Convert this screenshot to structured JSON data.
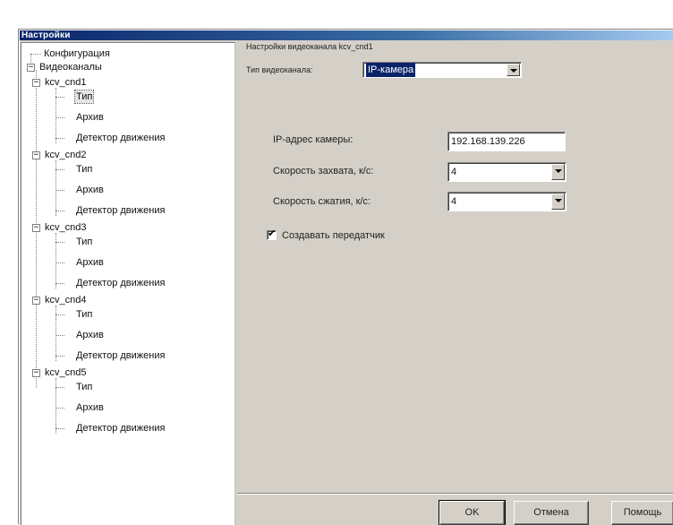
{
  "window": {
    "title": "Настройки"
  },
  "tree": {
    "configuration": "Конфигурация",
    "video_channels": "Видеоканалы",
    "channels": [
      {
        "name": "kcv_cnd1",
        "children": [
          "Тип",
          "Архив",
          "Детектор движения"
        ]
      },
      {
        "name": "kcv_cnd2",
        "children": [
          "Тип",
          "Архив",
          "Детектор движения"
        ]
      },
      {
        "name": "kcv_cnd3",
        "children": [
          "Тип",
          "Архив",
          "Детектор движения"
        ]
      },
      {
        "name": "kcv_cnd4",
        "children": [
          "Тип",
          "Архив",
          "Детектор движения"
        ]
      },
      {
        "name": "kcv_cnd5",
        "children": [
          "Тип",
          "Архив",
          "Детектор движения"
        ]
      }
    ],
    "expander_symbol": "−"
  },
  "panel": {
    "header": "Настройки видеоканала kcv_cnd1",
    "type_label": "Тип видеоканала:",
    "type_value": "IP-камера",
    "ip_label": "IP-адрес камеры:",
    "ip_value": "192.168.139.226",
    "capture_speed_label": "Скорость захвата, к/с:",
    "capture_speed_value": "4",
    "compress_speed_label": "Скорость сжатия, к/с:",
    "compress_speed_value": "4",
    "checkbox_label": "Создавать передатчик",
    "checkbox_checked": true,
    "check_glyph": "✔"
  },
  "buttons": {
    "ok": "OK",
    "cancel": "Отмена",
    "help": "Помощь"
  }
}
